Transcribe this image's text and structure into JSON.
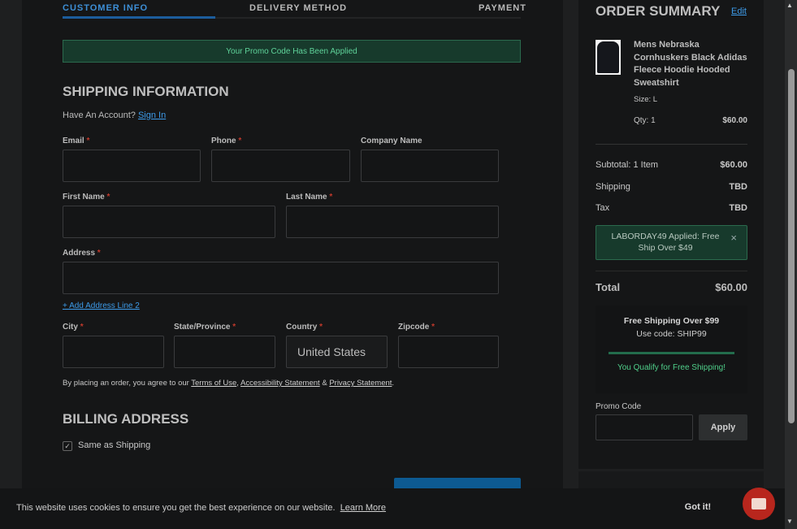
{
  "steps": [
    "CUSTOMER INFO",
    "DELIVERY METHOD",
    "PAYMENT"
  ],
  "promo_banner": "Your Promo Code Has Been Applied",
  "shipping": {
    "title": "SHIPPING INFORMATION",
    "account_prompt": "Have An Account?",
    "sign_in": "Sign In",
    "fields": {
      "email": "Email",
      "phone": "Phone",
      "company": "Company Name",
      "first": "First Name",
      "last": "Last Name",
      "address": "Address",
      "city": "City",
      "state": "State/Province",
      "country": "Country",
      "zip": "Zipcode"
    },
    "required_mark": "*",
    "add_line2": "+ Add Address Line 2",
    "country_value": "United States",
    "terms_prefix": "By placing an order, you agree to our",
    "terms": "Terms of Use",
    "comma": ",",
    "access": "Accessibility Statement",
    "amp": "&",
    "privacy": "Privacy Statement",
    "period": "."
  },
  "billing": {
    "title": "BILLING ADDRESS",
    "same": "Same as Shipping",
    "checked": true
  },
  "summary": {
    "title": "ORDER SUMMARY",
    "edit": "Edit",
    "item_name": "Mens Nebraska Cornhuskers Black Adidas Fleece Hoodie Hooded Sweatshirt",
    "size": "Size:  L",
    "qty": "Qty: 1",
    "item_price": "$60.00",
    "subtotal_label": "Subtotal: 1 Item",
    "subtotal": "$60.00",
    "shipping_label": "Shipping",
    "shipping": "TBD",
    "tax_label": "Tax",
    "tax": "TBD",
    "coupon": "LABORDAY49 Applied: Free Ship Over $49",
    "coupon_close": "×",
    "total_label": "Total",
    "total": "$60.00",
    "free_ship_title": "Free Shipping Over $99",
    "free_ship_code": "Use code: SHIP99",
    "free_ship_progress": 100,
    "free_ship_msg": "You Qualify for Free Shipping!",
    "promo_label": "Promo Code",
    "apply": "Apply"
  },
  "cookie": {
    "text": "This website uses cookies to ensure you get the best experience on our website.",
    "learn": "Learn More",
    "got_it": "Got it!"
  }
}
